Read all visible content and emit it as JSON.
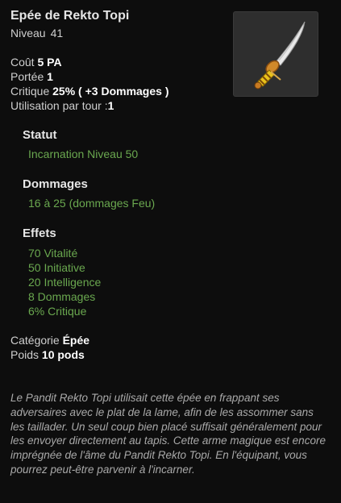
{
  "item": {
    "name": "Epée de Rekto Topi",
    "level_label": "Niveau",
    "level_value": "41",
    "icon": "curved-sword-icon"
  },
  "stats": [
    {
      "label": "Coût",
      "value": "5 PA"
    },
    {
      "label": "Portée",
      "value": "1"
    },
    {
      "label": "Critique",
      "value": "25% ( +3 Dommages )"
    },
    {
      "label": "Utilisation par tour :",
      "value": "1"
    }
  ],
  "statut": {
    "title": "Statut",
    "value": "Incarnation Niveau 50"
  },
  "dommages": {
    "title": "Dommages",
    "value": "16 à 25 (dommages Feu)"
  },
  "effets": {
    "title": "Effets",
    "items": [
      "70 Vitalité",
      "50 Initiative",
      "20 Intelligence",
      "8 Dommages",
      "6% Critique"
    ]
  },
  "category": {
    "label": "Catégorie",
    "value": "Épée"
  },
  "weight": {
    "label": "Poids",
    "value": "10 pods"
  },
  "description": "Le Pandit Rekto Topi utilisait cette épée en frappant ses adversaires avec le plat de la lame, afin de les assommer sans les taillader. Un seul coup bien placé suffisait généralement pour les envoyer directement au tapis. Cette arme magique est encore imprégnée de l'âme du Pandit Rekto Topi. En l'équipant, vous pourrez peut-être parvenir à l'incarner.",
  "colors": {
    "background": "#0d0d0d",
    "effect_green": "#6aa84f",
    "icon_box": "#2e2e2e"
  }
}
